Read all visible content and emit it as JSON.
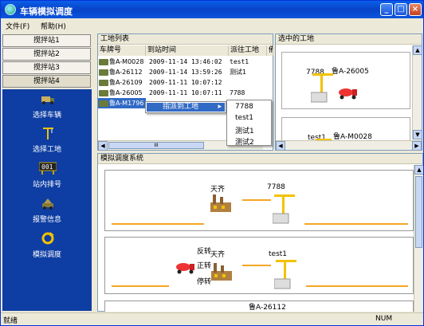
{
  "window": {
    "title": "车辆模拟调度"
  },
  "menu": [
    {
      "label": "文件(F)"
    },
    {
      "label": "帮助(H)"
    }
  ],
  "stations": [
    {
      "label": "搅拌站1"
    },
    {
      "label": "搅拌站2"
    },
    {
      "label": "搅拌站3"
    },
    {
      "label": "搅拌站4"
    }
  ],
  "nav": [
    {
      "label": "选择车辆",
      "icon": "truck-icon"
    },
    {
      "label": "选择工地",
      "icon": "crane-icon"
    },
    {
      "label": "站内排号",
      "icon": "counter-icon"
    },
    {
      "label": "报警信息",
      "icon": "alarm-icon"
    },
    {
      "label": "模拟调度",
      "icon": "refresh-icon"
    }
  ],
  "site_list": {
    "header": "工地列表",
    "columns": [
      "车牌号",
      "到站时间",
      "派往工地",
      "備"
    ],
    "rows": [
      {
        "plate": "鲁A-M0028",
        "time": "2009-11-14 13:46:02",
        "site": "test1"
      },
      {
        "plate": "鲁A-26112",
        "time": "2009-11-14 13:59:26",
        "site": "测试1"
      },
      {
        "plate": "鲁A-26109",
        "time": "2009-11-11 10:07:12",
        "site": ""
      },
      {
        "plate": "鲁A-26005",
        "time": "2009-11-11 10:07:11",
        "site": "7788"
      },
      {
        "plate": "鲁A-M1796",
        "time": "",
        "site": ""
      }
    ],
    "scroll_thumb": "III"
  },
  "context_menu": {
    "item": "指派到工地",
    "submenu": [
      "7788",
      "test1",
      "测试1",
      "测试2"
    ]
  },
  "selected_site": {
    "header": "选中的工地",
    "cards": [
      {
        "site": "7788",
        "plate": "鲁A-26005"
      },
      {
        "site": "test1",
        "plate": "鲁A-M0028"
      }
    ]
  },
  "simulation": {
    "header": "模拟调度系统",
    "lanes": [
      {
        "station": "天齐",
        "site": "7788",
        "controls": []
      },
      {
        "station": "天齐",
        "site": "test1",
        "controls": [
          "反转",
          "正转",
          "停转"
        ]
      },
      {
        "station": "",
        "site": "",
        "plate": "鲁A-26112",
        "controls": []
      }
    ]
  },
  "status": {
    "left": "就绪",
    "num": "NUM"
  },
  "colors": {
    "accent": "#0E3EA3",
    "title": "#0A55DD",
    "road": "#F5A623",
    "selection": "#316AC5"
  }
}
